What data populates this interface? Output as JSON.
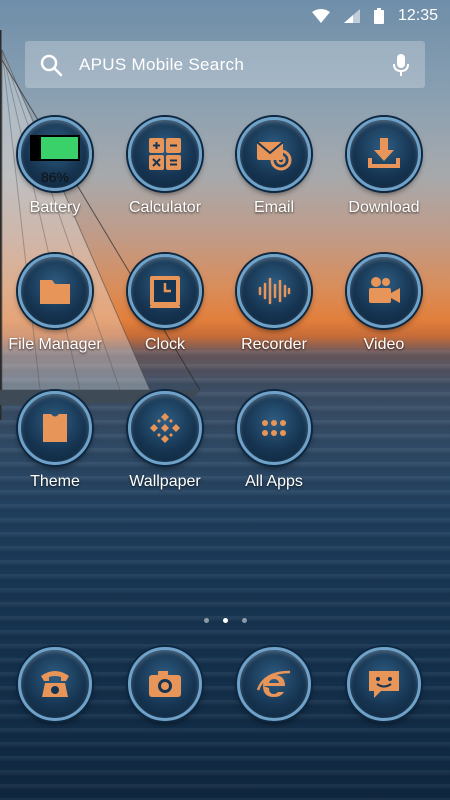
{
  "status_bar": {
    "time": "12:35"
  },
  "search": {
    "label": "APUS Mobile Search"
  },
  "battery": {
    "percent_text": "86%",
    "level_percent": 86
  },
  "apps": [
    {
      "label": "Battery",
      "icon": "battery-icon"
    },
    {
      "label": "Calculator",
      "icon": "calculator-icon"
    },
    {
      "label": "Email",
      "icon": "email-icon"
    },
    {
      "label": "Download",
      "icon": "download-icon"
    },
    {
      "label": "File Manager",
      "icon": "folder-icon"
    },
    {
      "label": "Clock",
      "icon": "clock-icon"
    },
    {
      "label": "Recorder",
      "icon": "recorder-icon"
    },
    {
      "label": "Video",
      "icon": "video-camera-icon"
    },
    {
      "label": "Theme",
      "icon": "shirt-icon"
    },
    {
      "label": "Wallpaper",
      "icon": "wallpaper-icon"
    },
    {
      "label": "All Apps",
      "icon": "grid-icon"
    }
  ],
  "dock": [
    {
      "icon": "phone-icon"
    },
    {
      "icon": "camera-icon"
    },
    {
      "icon": "browser-icon"
    },
    {
      "icon": "message-icon"
    }
  ],
  "page_indicator": {
    "count": 3,
    "active_index": 1
  },
  "colors": {
    "icon_accent": "#e8955a",
    "ring": "#6fa2c9",
    "battery_green": "#3bd16a"
  }
}
